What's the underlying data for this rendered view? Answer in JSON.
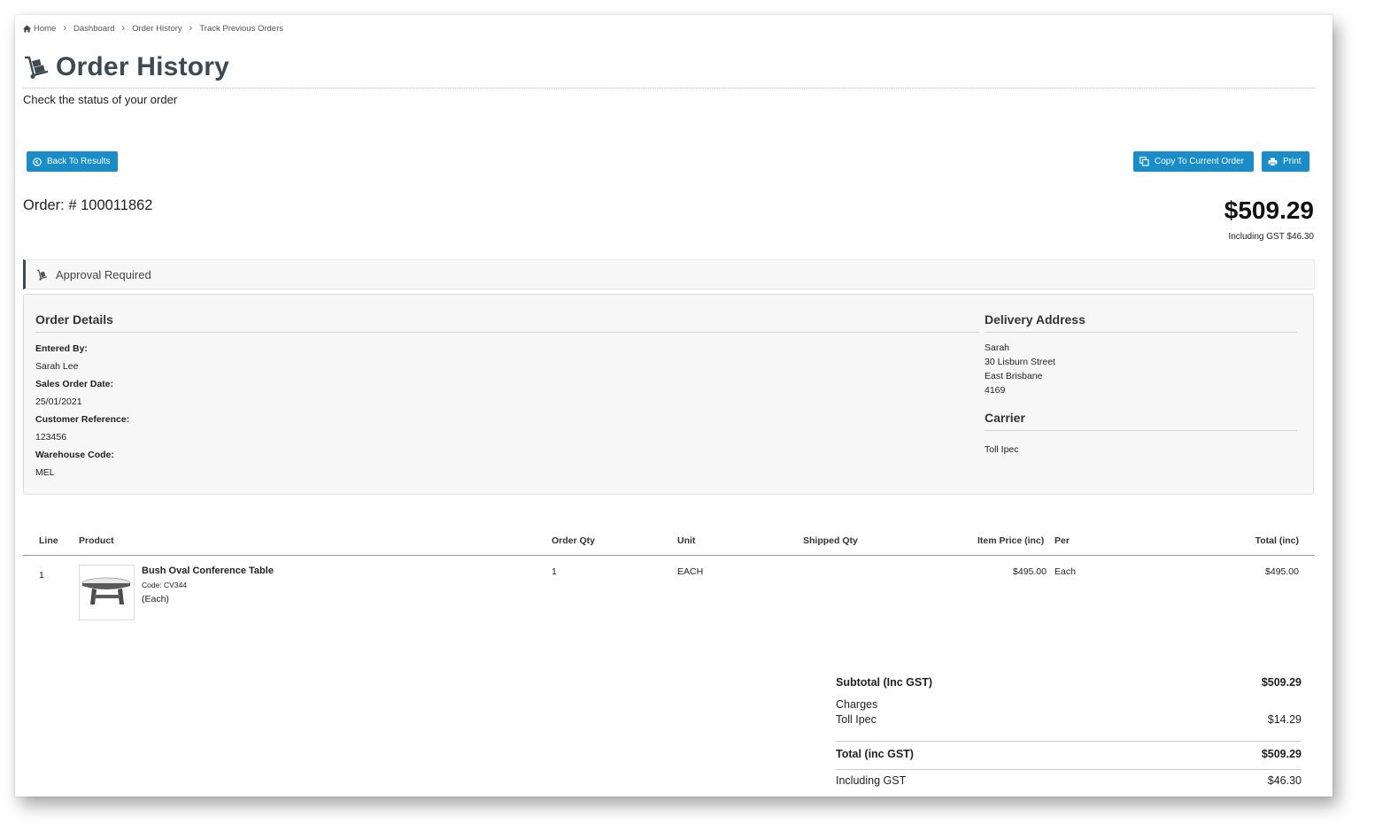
{
  "breadcrumb": {
    "home": "Home",
    "items": [
      "Dashboard",
      "Order History",
      "Track Previous Orders"
    ]
  },
  "page": {
    "title": "Order History",
    "subtitle": "Check the status of your order"
  },
  "buttons": {
    "back": "Back To Results",
    "copy": "Copy To Current Order",
    "print": "Print"
  },
  "order": {
    "number_label": "Order: # 100011862",
    "total": "$509.29",
    "including_gst": "Including GST $46.30",
    "status": "Approval Required"
  },
  "details": {
    "heading": "Order Details",
    "entered_by_label": "Entered By:",
    "entered_by": "Sarah Lee",
    "sales_order_date_label": "Sales Order Date:",
    "sales_order_date": "25/01/2021",
    "customer_reference_label": "Customer Reference:",
    "customer_reference": "123456",
    "warehouse_code_label": "Warehouse Code:",
    "warehouse_code": "MEL"
  },
  "delivery": {
    "heading": "Delivery Address",
    "lines": [
      "Sarah",
      "30 Lisburn Street",
      "East Brisbane",
      "4169"
    ],
    "carrier_heading": "Carrier",
    "carrier": "Toll Ipec"
  },
  "table": {
    "headers": {
      "line": "Line",
      "product": "Product",
      "order_qty": "Order Qty",
      "unit": "Unit",
      "shipped_qty": "Shipped Qty",
      "item_price": "Item Price (inc)",
      "per": "Per",
      "total": "Total (inc)"
    },
    "rows": [
      {
        "line": "1",
        "product_name": "Bush Oval Conference Table",
        "code": "Code: CV344",
        "unit_note": "(Each)",
        "order_qty": "1",
        "unit": "EACH",
        "shipped_qty": "",
        "item_price": "$495.00",
        "per": "Each",
        "total": "$495.00"
      }
    ]
  },
  "totals": {
    "subtotal_label": "Subtotal (Inc GST)",
    "subtotal": "$509.29",
    "charges_label": "Charges",
    "charge_name": "Toll Ipec",
    "charge_value": "$14.29",
    "total_label": "Total (inc GST)",
    "total": "$509.29",
    "gst_label": "Including GST",
    "gst": "$46.30"
  },
  "colors": {
    "button_blue": "#1a8cc7",
    "title_slate": "#3d4a52",
    "panel_bg": "#f7f7f7"
  },
  "icons": {
    "home": "home-icon",
    "title": "hand-truck-icon",
    "back": "circle-arrow-left-icon",
    "copy": "copy-icon",
    "print": "printer-icon",
    "approval": "hand-truck-icon",
    "breadcrumb_separator": "chevron-right-icon"
  }
}
